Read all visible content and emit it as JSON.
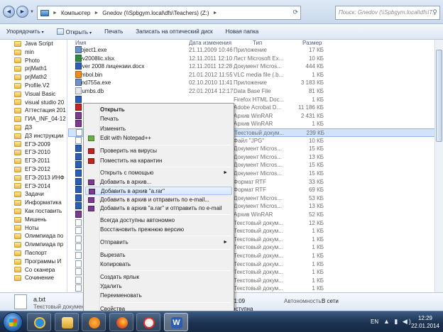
{
  "nav": {
    "back_label": "◄",
    "forward_label": "►",
    "history_caret": "▼"
  },
  "address": {
    "segments": [
      "Компьютер",
      "Gnedov (\\\\Spbgym.local\\dfs\\Teachers) (Z:)"
    ],
    "separator": "►"
  },
  "search": {
    "placeholder": "Поиск: Gnedov (\\\\Spbgym.local\\dfs\\T..."
  },
  "toolbar": {
    "organize": "Упорядочить",
    "open": "Открыть",
    "print": "Печать",
    "burn": "Записать на оптический диск",
    "new_folder": "Новая папка",
    "caret": "▾"
  },
  "nav_pane": {
    "items": [
      "Java Script",
      "min",
      "Photo",
      "prjMath1",
      "prjMath2",
      "Profile.V2",
      "Visual Basic",
      "visual studio 20",
      "Аттестация 201",
      "ГИА_INF_04-12",
      "ДЗ",
      "ДЗ инструкции",
      "ЕГЭ-2009",
      "ЕГЭ-2010",
      "ЕГЭ-2011",
      "ЕГЭ-2012",
      "ЕГЭ-2013 ИНФ",
      "ЕГЭ-2014",
      "Задачи",
      "Информатика",
      "Как поставить",
      "Мишень",
      "Ноты",
      "Олимпиада по",
      "Олимпиада пр",
      "Паспорт",
      "Программы И",
      "Со сканера",
      "Сочинение"
    ]
  },
  "columns": {
    "name": "Имя",
    "date": "Дата изменения",
    "type": "Тип",
    "size": "Размер"
  },
  "files": [
    {
      "name": "Project1.exe",
      "date": "21.11.2009 10:46",
      "type": "Приложение",
      "size": "17 КБ",
      "icon": "exe"
    },
    {
      "name": "Sev2008lic.xlsx",
      "date": "12.11.2011 12:10",
      "type": "Лист Microsoft Ex...",
      "size": "10 КБ",
      "icon": "xls"
    },
    {
      "name": "Sever 2008 лицензии.docx",
      "date": "12.11.2011 12:28",
      "type": "Документ Micros...",
      "size": "444 КБ",
      "icon": "doc"
    },
    {
      "name": "symbol.bin",
      "date": "21.01.2012 11:55",
      "type": "VLC media file (.b...",
      "size": "1 КБ",
      "icon": "vlc"
    },
    {
      "name": "tcmd755a.exe",
      "date": "02.10.2010 11:41",
      "type": "Приложение",
      "size": "3 183 КБ",
      "icon": "exe"
    },
    {
      "name": "Thumbs.db",
      "date": "22.01.2014 12:17",
      "type": "Data Base File",
      "size": "81 КБ",
      "icon": "db"
    },
    {
      "name": "",
      "date": "",
      "type": "Firefox HTML Doc...",
      "size": "1 КБ",
      "icon": "doc"
    },
    {
      "name": "",
      "date": "",
      "type": "Adobe Acrobat D...",
      "size": "11 186 КБ",
      "icon": "pdf"
    },
    {
      "name": "",
      "date": "",
      "type": "Архив WinRAR",
      "size": "2 431 КБ",
      "icon": "rar"
    },
    {
      "name": "",
      "date": "",
      "type": "Архив WinRAR",
      "size": "1 КБ",
      "icon": "rar"
    },
    {
      "name": "",
      "date": "",
      "type": "Текстовый докум...",
      "size": "239 КБ",
      "icon": "txt"
    },
    {
      "name": "",
      "date": "",
      "type": "Файл \"JPG\"",
      "size": "10 КБ",
      "icon": "txt"
    },
    {
      "name": "",
      "date": "",
      "type": "Документ Micros...",
      "size": "15 КБ",
      "icon": "doc"
    },
    {
      "name": "",
      "date": "",
      "type": "Документ Micros...",
      "size": "13 КБ",
      "icon": "doc"
    },
    {
      "name": "",
      "date": "",
      "type": "Документ Micros...",
      "size": "15 КБ",
      "icon": "doc"
    },
    {
      "name": "",
      "date": "",
      "type": "Документ Micros...",
      "size": "15 КБ",
      "icon": "doc"
    },
    {
      "name": "",
      "date": "",
      "type": "Формат RTF",
      "size": "33 КБ",
      "icon": "doc"
    },
    {
      "name": "",
      "date": "",
      "type": "Формат RTF",
      "size": "69 КБ",
      "icon": "doc"
    },
    {
      "name": "",
      "date": "",
      "type": "Документ Micros...",
      "size": "53 КБ",
      "icon": "doc"
    },
    {
      "name": "",
      "date": "",
      "type": "Документ Micros...",
      "size": "13 КБ",
      "icon": "doc"
    },
    {
      "name": "",
      "date": "",
      "type": "Архив WinRAR",
      "size": "52 КБ",
      "icon": "rar"
    },
    {
      "name": "",
      "date": "",
      "type": "Текстовый докум...",
      "size": "12 КБ",
      "icon": "txt"
    },
    {
      "name": "",
      "date": "",
      "type": "Текстовый докум...",
      "size": "1 КБ",
      "icon": "txt"
    },
    {
      "name": "",
      "date": "",
      "type": "Текстовый докум...",
      "size": "1 КБ",
      "icon": "txt"
    },
    {
      "name": "",
      "date": "",
      "type": "Текстовый докум...",
      "size": "1 КБ",
      "icon": "txt"
    },
    {
      "name": "",
      "date": "",
      "type": "Текстовый докум...",
      "size": "1 КБ",
      "icon": "txt"
    },
    {
      "name": "",
      "date": "",
      "type": "Текстовый докум...",
      "size": "1 КБ",
      "icon": "txt"
    },
    {
      "name": "",
      "date": "",
      "type": "Текстовый докум...",
      "size": "1 КБ",
      "icon": "txt"
    },
    {
      "name": "",
      "date": "",
      "type": "Текстовый докум...",
      "size": "1 КБ",
      "icon": "txt"
    },
    {
      "name": "",
      "date": "",
      "type": "Текстовый докум...",
      "size": "1 КБ",
      "icon": "txt"
    }
  ],
  "selected_file_index": 10,
  "context_menu": {
    "open": "Открыть",
    "print": "Печать",
    "edit": "Изменить",
    "notepad": "Edit with Notepad++",
    "scan": "Проверить на вирусы",
    "quarantine": "Поместить на карантин",
    "open_with": "Открыть с помощью",
    "add_archive": "Добавить в архив...",
    "add_a_rar": "Добавить в архив \"a.rar\"",
    "add_email": "Добавить в архив и отправить по e-mail...",
    "add_a_rar_email": "Добавить в архив \"a.rar\" и отправить по e-mail",
    "offline": "Всегда доступны автономно",
    "restore": "Восстановить прежнюю версию",
    "send_to": "Отправить",
    "cut": "Вырезать",
    "copy": "Копировать",
    "shortcut": "Создать ярлык",
    "delete": "Удалить",
    "rename": "Переименовать",
    "properties": "Свойства",
    "submenu_arrow": "►"
  },
  "details": {
    "file_name": "a.txt",
    "file_type": "Текстовый документ",
    "modified_fragment": "1.2014 11:09",
    "availability_label": "Автономность:",
    "availability_value": "В сети",
    "network_fragment": "оступна"
  },
  "taskbar": {
    "apps": [
      "internet-explorer",
      "file-explorer",
      "media-player",
      "firefox",
      "yandex",
      "word"
    ],
    "active_app": "word",
    "word_glyph": "W",
    "lang": "EN",
    "tray_icons": "▲ ▮ ◀)",
    "time": "12:29",
    "date": "22.01.2014"
  }
}
